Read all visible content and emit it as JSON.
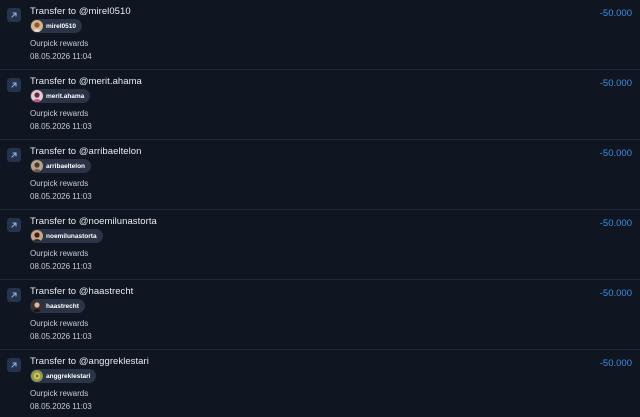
{
  "icons": {
    "row_icon": "outgoing-arrow-icon",
    "avatar": "avatar-icon"
  },
  "colors": {
    "background": "#0f1521",
    "amount": "#3d8fe6",
    "chip": "#2a3446",
    "icon_bg": "#25344b"
  },
  "transactions": [
    {
      "title": "Transfer to @mirel0510",
      "username": "mirel0510",
      "description": "Ourpick rewards",
      "date": "08.05.2026 11:04",
      "amount": "-50.000"
    },
    {
      "title": "Transfer to @merit.ahama",
      "username": "merit.ahama",
      "description": "Ourpick rewards",
      "date": "08.05.2026 11:03",
      "amount": "-50.000"
    },
    {
      "title": "Transfer to @arribaeltelon",
      "username": "arribaeltelon",
      "description": "Ourpick rewards",
      "date": "08.05.2026 11:03",
      "amount": "-50.000"
    },
    {
      "title": "Transfer to @noemilunastorta",
      "username": "noemilunastorta",
      "description": "Ourpick rewards",
      "date": "08.05.2026 11:03",
      "amount": "-50.000"
    },
    {
      "title": "Transfer to @haastrecht",
      "username": "haastrecht",
      "description": "Ourpick rewards",
      "date": "08.05.2026 11:03",
      "amount": "-50.000"
    },
    {
      "title": "Transfer to @anggreklestari",
      "username": "anggreklestari",
      "description": "Ourpick rewards",
      "date": "08.05.2026 11:03",
      "amount": "-50.000"
    }
  ]
}
